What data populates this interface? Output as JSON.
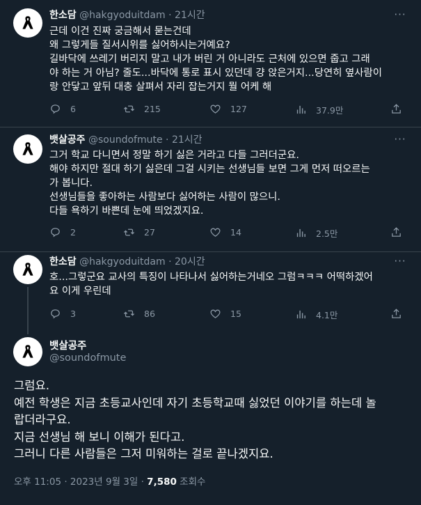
{
  "replies": [
    {
      "name": "한소담",
      "handle": "@hakgyoduitdam",
      "dot": "·",
      "time": "21시간",
      "text": "근데 이건 진짜 궁금해서 묻는건데\n왜 그렇게들 질서시위를 싫어하시는거예요?\n길바닥에 쓰레기 버리지 말고 내가 버린 거 아니라도 근처에 있으면 줍고 그래\n야 하는 거 아님? 줄도...바닥에 통로 표시 있던데 걍 앉은거지...당연히 옆사람이\n랑 안닿고 앞뒤 대충 살펴서 자리 잡는거지 뭘 어케 해",
      "replies": "6",
      "retweets": "215",
      "likes": "127",
      "views": "37.9만"
    },
    {
      "name": "뱃살공주",
      "handle": "@soundofmute",
      "dot": "·",
      "time": "21시간",
      "text": "그거 학교 다니면서 정말 하기 싫은 거라고 다들 그러더군요.\n해야 하지만 절대 하기 싫은데 그걸 시키는 선생님들 보면 그게 먼저 떠오르는\n가 봅니다.\n선생님들을 좋아하는 사람보다 싫어하는 사람이 많으니.\n다들 욕하기 바쁜데 눈에 띄었겠지요.",
      "replies": "2",
      "retweets": "27",
      "likes": "14",
      "views": "2.5만"
    },
    {
      "name": "한소담",
      "handle": "@hakgyoduitdam",
      "dot": "·",
      "time": "20시간",
      "text": "호...그렇군요 교사의 특징이 나타나서 싫어하는거네오 그럼ㅋㅋㅋ 어떡하겠어\n요 이게 우린데",
      "replies": "3",
      "retweets": "86",
      "likes": "15",
      "views": "4.1만"
    }
  ],
  "main": {
    "name": "뱃살공주",
    "handle": "@soundofmute",
    "text": "그럼요.\n예전 학생은 지금 초등교사인데 자기 초등학교때 싫었던 이야기를 하는데 놀\n랍더라구요.\n지금 선생님 해 보니 이해가 된다고.\n그러니 다른 사람들은 그저 미워하는 걸로 끝나겠지요.",
    "timestamp": "오후 11:05 · 2023년 9월 3일 · ",
    "views_count": "7,580",
    "views_label": " 조회수"
  },
  "icons": {
    "avatar": "black-ribbon-icon",
    "more": "more-dots-icon",
    "reply": "reply-icon",
    "retweet": "retweet-icon",
    "like": "like-icon",
    "views": "views-icon",
    "share": "share-icon"
  },
  "colors": {
    "background": "#15202b",
    "text": "#f7f9f9",
    "muted": "#8b98a5",
    "divider": "#38444d"
  }
}
